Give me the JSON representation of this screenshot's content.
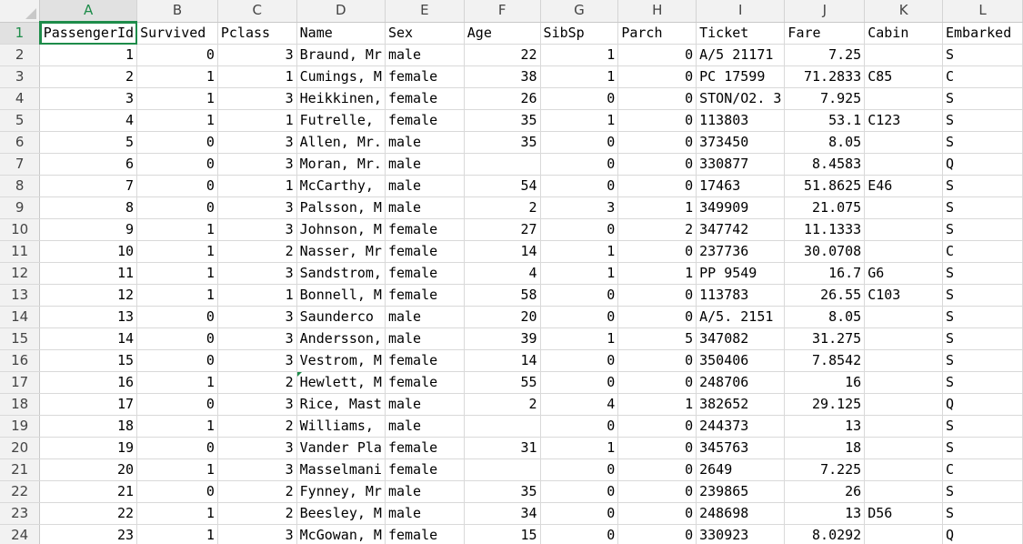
{
  "columns": [
    "A",
    "B",
    "C",
    "D",
    "E",
    "F",
    "G",
    "H",
    "I",
    "J",
    "K",
    "L"
  ],
  "active_column": "A",
  "active_row": 1,
  "header_row": [
    "PassengerId",
    "Survived",
    "Pclass",
    "Name",
    "Sex",
    "Age",
    "SibSp",
    "Parch",
    "Ticket",
    "Fare",
    "Cabin",
    "Embarked"
  ],
  "rows": [
    {
      "num": "2",
      "cells": [
        "1",
        "0",
        "3",
        "Braund, Mr",
        "male",
        "22",
        "1",
        "0",
        "A/5 21171",
        "7.25",
        "",
        "S"
      ]
    },
    {
      "num": "3",
      "cells": [
        "2",
        "1",
        "1",
        "Cumings, M",
        "female",
        "38",
        "1",
        "0",
        "PC 17599",
        "71.2833",
        "C85",
        "C"
      ]
    },
    {
      "num": "4",
      "cells": [
        "3",
        "1",
        "3",
        "Heikkinen,",
        "female",
        "26",
        "0",
        "0",
        "STON/O2. 3",
        "7.925",
        "",
        "S"
      ]
    },
    {
      "num": "5",
      "cells": [
        "4",
        "1",
        "1",
        "Futrelle, ",
        "female",
        "35",
        "1",
        "0",
        "113803",
        "53.1",
        "C123",
        "S"
      ]
    },
    {
      "num": "6",
      "cells": [
        "5",
        "0",
        "3",
        "Allen, Mr.",
        "male",
        "35",
        "0",
        "0",
        "373450",
        "8.05",
        "",
        "S"
      ]
    },
    {
      "num": "7",
      "cells": [
        "6",
        "0",
        "3",
        "Moran, Mr.",
        "male",
        "",
        "0",
        "0",
        "330877",
        "8.4583",
        "",
        "Q"
      ]
    },
    {
      "num": "8",
      "cells": [
        "7",
        "0",
        "1",
        "McCarthy, ",
        "male",
        "54",
        "0",
        "0",
        "17463",
        "51.8625",
        "E46",
        "S"
      ]
    },
    {
      "num": "9",
      "cells": [
        "8",
        "0",
        "3",
        "Palsson, M",
        "male",
        "2",
        "3",
        "1",
        "349909",
        "21.075",
        "",
        "S"
      ]
    },
    {
      "num": "10",
      "cells": [
        "9",
        "1",
        "3",
        "Johnson, M",
        "female",
        "27",
        "0",
        "2",
        "347742",
        "11.1333",
        "",
        "S"
      ]
    },
    {
      "num": "11",
      "cells": [
        "10",
        "1",
        "2",
        "Nasser, Mr",
        "female",
        "14",
        "1",
        "0",
        "237736",
        "30.0708",
        "",
        "C"
      ]
    },
    {
      "num": "12",
      "cells": [
        "11",
        "1",
        "3",
        "Sandstrom,",
        "female",
        "4",
        "1",
        "1",
        "PP 9549",
        "16.7",
        "G6",
        "S"
      ]
    },
    {
      "num": "13",
      "cells": [
        "12",
        "1",
        "1",
        "Bonnell, M",
        "female",
        "58",
        "0",
        "0",
        "113783",
        "26.55",
        "C103",
        "S"
      ]
    },
    {
      "num": "14",
      "cells": [
        "13",
        "0",
        "3",
        "Saunderco",
        "male",
        "20",
        "0",
        "0",
        "A/5. 2151",
        "8.05",
        "",
        "S"
      ]
    },
    {
      "num": "15",
      "cells": [
        "14",
        "0",
        "3",
        "Andersson,",
        "male",
        "39",
        "1",
        "5",
        "347082",
        "31.275",
        "",
        "S"
      ]
    },
    {
      "num": "16",
      "cells": [
        "15",
        "0",
        "3",
        "Vestrom, M",
        "female",
        "14",
        "0",
        "0",
        "350406",
        "7.8542",
        "",
        "S"
      ]
    },
    {
      "num": "17",
      "cells": [
        "16",
        "1",
        "2",
        "Hewlett, M",
        "female",
        "55",
        "0",
        "0",
        "248706",
        "16",
        "",
        "S"
      ]
    },
    {
      "num": "18",
      "cells": [
        "17",
        "0",
        "3",
        "Rice, Mast",
        "male",
        "2",
        "4",
        "1",
        "382652",
        "29.125",
        "",
        "Q"
      ]
    },
    {
      "num": "19",
      "cells": [
        "18",
        "1",
        "2",
        "Williams, ",
        "male",
        "",
        "0",
        "0",
        "244373",
        "13",
        "",
        "S"
      ]
    },
    {
      "num": "20",
      "cells": [
        "19",
        "0",
        "3",
        "Vander Pla",
        "female",
        "31",
        "1",
        "0",
        "345763",
        "18",
        "",
        "S"
      ]
    },
    {
      "num": "21",
      "cells": [
        "20",
        "1",
        "3",
        "Masselmani",
        "female",
        "",
        "0",
        "0",
        "2649",
        "7.225",
        "",
        "C"
      ]
    },
    {
      "num": "22",
      "cells": [
        "21",
        "0",
        "2",
        "Fynney, Mr",
        "male",
        "35",
        "0",
        "0",
        "239865",
        "26",
        "",
        "S"
      ]
    },
    {
      "num": "23",
      "cells": [
        "22",
        "1",
        "2",
        "Beesley, M",
        "male",
        "34",
        "0",
        "0",
        "248698",
        "13",
        "D56",
        "S"
      ]
    },
    {
      "num": "24",
      "cells": [
        "23",
        "1",
        "3",
        "McGowan, M",
        "female",
        "15",
        "0",
        "0",
        "330923",
        "8.0292",
        "",
        "Q"
      ]
    }
  ],
  "numeric_columns": [
    0,
    1,
    2,
    5,
    6,
    7,
    9
  ],
  "colors": {
    "accent": "#1e8c4a",
    "header_bg": "#f2f2f2",
    "gridline": "#d9d9d9"
  }
}
